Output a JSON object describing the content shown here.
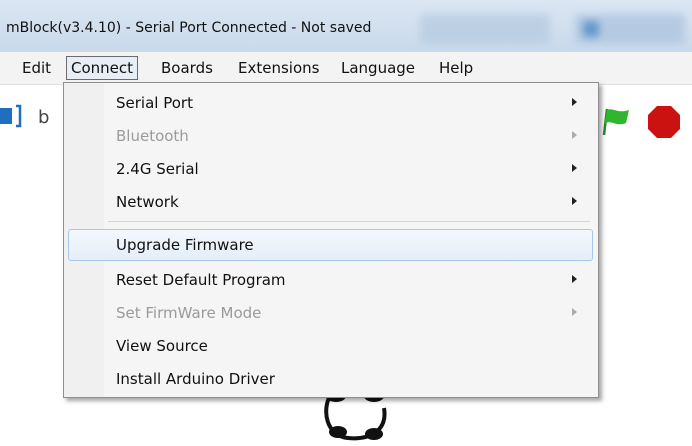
{
  "window": {
    "title": "mBlock(v3.4.10) - Serial Port Connected - Not saved"
  },
  "menubar": {
    "items": [
      {
        "label": "Edit"
      },
      {
        "label": "Connect"
      },
      {
        "label": "Boards"
      },
      {
        "label": "Extensions"
      },
      {
        "label": "Language"
      },
      {
        "label": "Help"
      }
    ],
    "active": "Connect"
  },
  "toolbar": {
    "partial_text": "b"
  },
  "connect_menu": {
    "items": [
      {
        "label": "Serial Port",
        "enabled": true,
        "submenu": true
      },
      {
        "label": "Bluetooth",
        "enabled": false,
        "submenu": true
      },
      {
        "label": "2.4G Serial",
        "enabled": true,
        "submenu": true
      },
      {
        "label": "Network",
        "enabled": true,
        "submenu": true
      },
      {
        "label": "Upgrade Firmware",
        "enabled": true,
        "submenu": false,
        "highlighted": true
      },
      {
        "label": "Reset Default Program",
        "enabled": true,
        "submenu": true
      },
      {
        "label": "Set FirmWare Mode",
        "enabled": false,
        "submenu": true
      },
      {
        "label": "View Source",
        "enabled": true,
        "submenu": false
      },
      {
        "label": "Install Arduino Driver",
        "enabled": true,
        "submenu": false
      }
    ]
  },
  "colors": {
    "flag": "#2fb52f",
    "stop": "#cc1111",
    "highlight_border": "#a9c7e8"
  }
}
